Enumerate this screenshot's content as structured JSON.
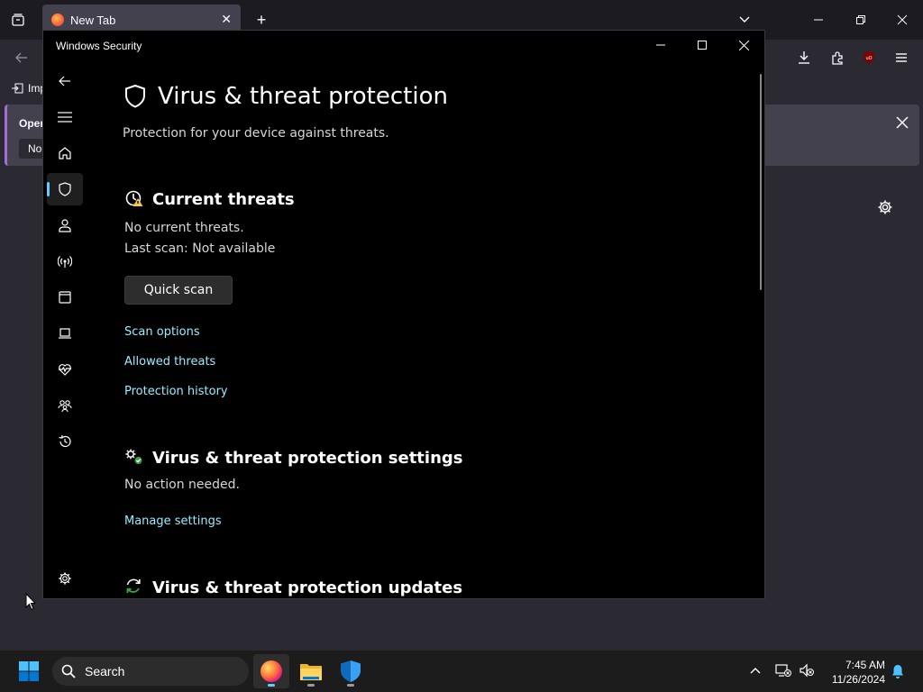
{
  "firefox": {
    "tab_title": "New Tab",
    "bookmark_label": "Imp",
    "notice_title": "Open",
    "notice_button": "No"
  },
  "window": {
    "title": "Windows Security"
  },
  "page": {
    "title": "Virus & threat protection",
    "subtitle": "Protection for your device against threats."
  },
  "current_threats": {
    "heading": "Current threats",
    "status": "No current threats.",
    "last_scan": "Last scan: Not available",
    "quick_scan_label": "Quick scan",
    "links": [
      "Scan options",
      "Allowed threats",
      "Protection history"
    ]
  },
  "settings_section": {
    "heading": "Virus & threat protection settings",
    "status": "No action needed.",
    "link": "Manage settings"
  },
  "updates_section": {
    "heading": "Virus & threat protection updates"
  },
  "taskbar": {
    "search_placeholder": "Search",
    "time": "7:45 AM",
    "date": "11/26/2024"
  },
  "colors": {
    "accent": "#60cdff",
    "link": "#99ebff",
    "window_bg": "#000000"
  }
}
